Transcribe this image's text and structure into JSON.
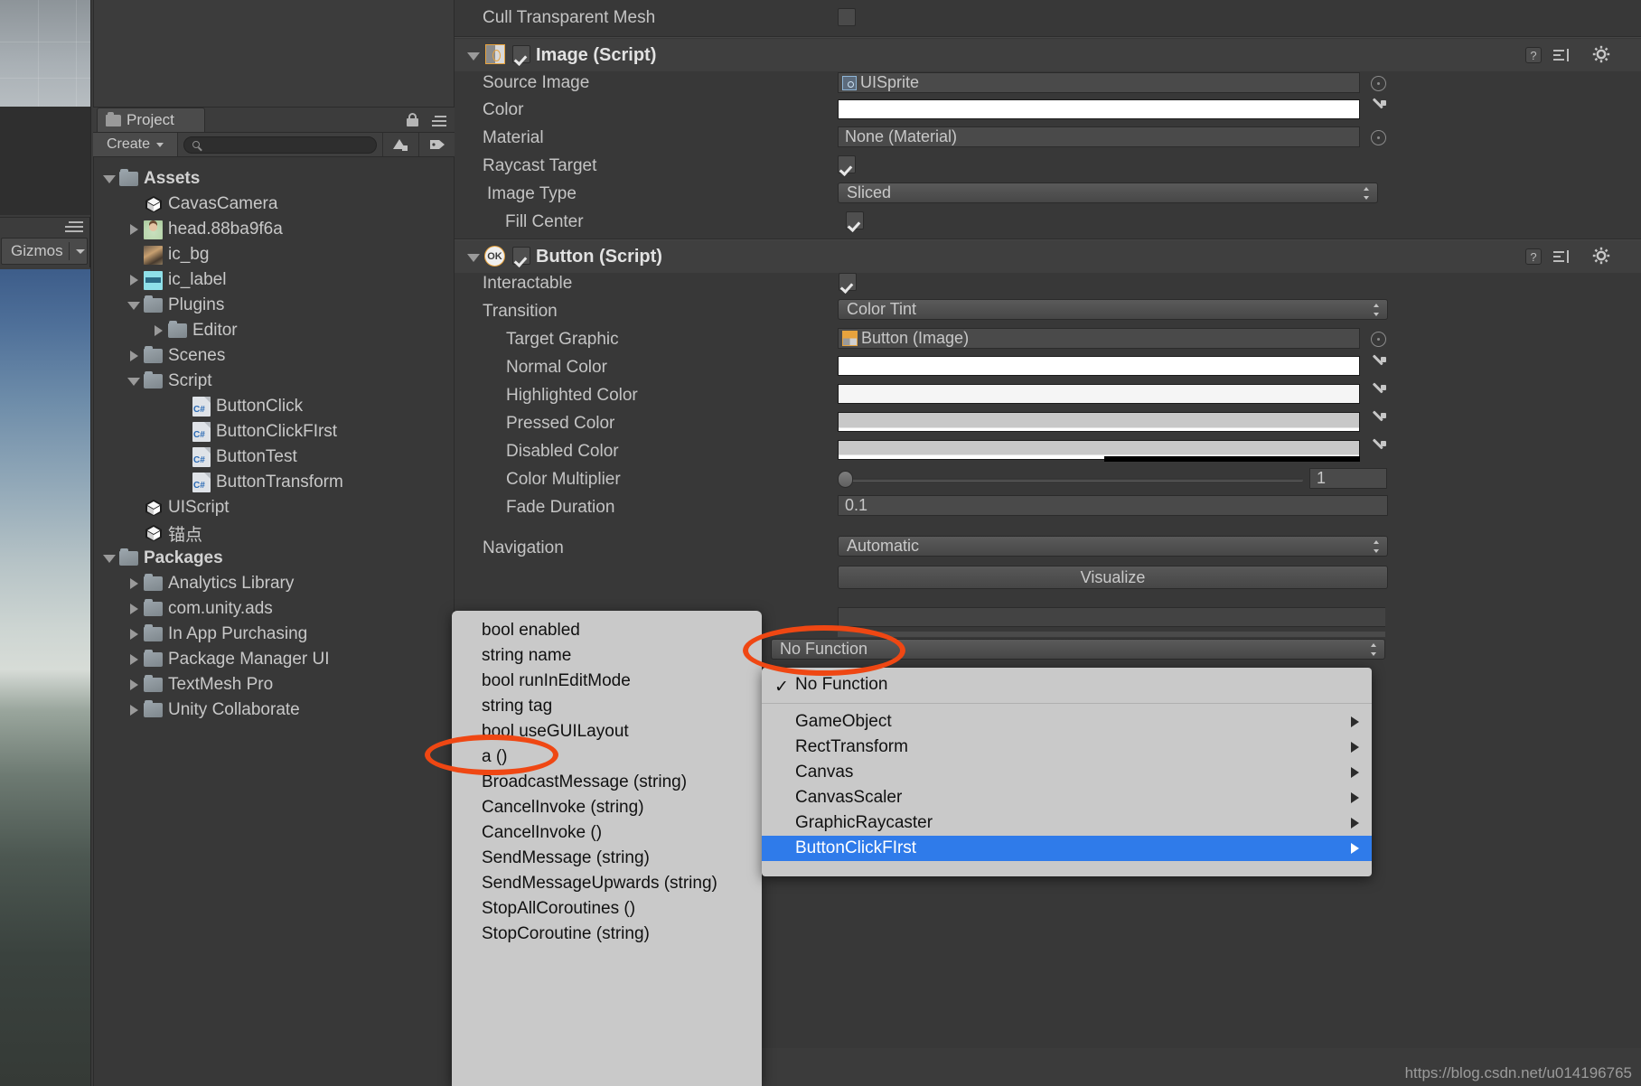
{
  "scene": {
    "gizmos_label": "Gizmos",
    "gizmos_menu_icon": "hamburger-menu-icon",
    "gizmos_caret_icon": "caret-down-icon"
  },
  "project": {
    "tab_label": "Project",
    "tab_icon": "folder-icon",
    "lock_icon": "lock-icon",
    "menu_icon": "hamburger-menu-icon",
    "create_label": "Create",
    "search_placeholder": "",
    "search_value": "",
    "search_icon": "magnifier-icon",
    "toolbar_icons": [
      "favorite-filter-icon",
      "label-filter-icon"
    ],
    "tree": [
      {
        "label": "Assets",
        "icon": "folder-icon",
        "twisty": "open",
        "depth": 0,
        "bold": true
      },
      {
        "label": "CavasCamera",
        "icon": "unity-prefab-icon",
        "twisty": "none",
        "depth": 1,
        "bold": false
      },
      {
        "label": "head.88ba9f6a",
        "icon": "image-head-icon",
        "twisty": "closed",
        "depth": 1,
        "bold": false
      },
      {
        "label": "ic_bg",
        "icon": "image-bg-icon",
        "twisty": "none",
        "depth": 1,
        "bold": false
      },
      {
        "label": "ic_label",
        "icon": "image-label-icon",
        "twisty": "closed",
        "depth": 1,
        "bold": false
      },
      {
        "label": "Plugins",
        "icon": "folder-icon",
        "twisty": "open",
        "depth": 1,
        "bold": false
      },
      {
        "label": "Editor",
        "icon": "folder-icon",
        "twisty": "closed",
        "depth": 2,
        "bold": false
      },
      {
        "label": "Scenes",
        "icon": "folder-icon",
        "twisty": "closed",
        "depth": 1,
        "bold": false
      },
      {
        "label": "Script",
        "icon": "folder-icon",
        "twisty": "open",
        "depth": 1,
        "bold": false
      },
      {
        "label": "ButtonClick",
        "icon": "csharp-script-icon",
        "twisty": "none",
        "depth": 3,
        "bold": false
      },
      {
        "label": "ButtonClickFIrst",
        "icon": "csharp-script-icon",
        "twisty": "none",
        "depth": 3,
        "bold": false
      },
      {
        "label": "ButtonTest",
        "icon": "csharp-script-icon",
        "twisty": "none",
        "depth": 3,
        "bold": false
      },
      {
        "label": "ButtonTransform",
        "icon": "csharp-script-icon",
        "twisty": "none",
        "depth": 3,
        "bold": false
      },
      {
        "label": "UIScript",
        "icon": "unity-prefab-icon",
        "twisty": "none",
        "depth": 1,
        "bold": false
      },
      {
        "label": "锚点",
        "icon": "unity-prefab-icon",
        "twisty": "none",
        "depth": 1,
        "bold": false
      },
      {
        "label": "Packages",
        "icon": "folder-icon",
        "twisty": "open",
        "depth": 0,
        "bold": true
      },
      {
        "label": "Analytics Library",
        "icon": "folder-icon",
        "twisty": "closed",
        "depth": 1,
        "bold": false
      },
      {
        "label": "com.unity.ads",
        "icon": "folder-icon",
        "twisty": "closed",
        "depth": 1,
        "bold": false
      },
      {
        "label": "In App Purchasing",
        "icon": "folder-icon",
        "twisty": "closed",
        "depth": 1,
        "bold": false
      },
      {
        "label": "Package Manager UI",
        "icon": "folder-icon",
        "twisty": "closed",
        "depth": 1,
        "bold": false
      },
      {
        "label": "TextMesh Pro",
        "icon": "folder-icon",
        "twisty": "closed",
        "depth": 1,
        "bold": false
      },
      {
        "label": "Unity Collaborate",
        "icon": "folder-icon",
        "twisty": "closed",
        "depth": 1,
        "bold": false
      }
    ]
  },
  "inspector": {
    "cull_transparent_mesh": {
      "label": "Cull Transparent Mesh",
      "checked": false
    },
    "image_component": {
      "title": "Image (Script)",
      "enabled": true,
      "badge": "image-script-badge-icon",
      "help_icon": "help-icon",
      "preset_icon": "preset-icon",
      "gear_icon": "gear-icon",
      "rows": [
        {
          "label": "Source Image",
          "type": "object",
          "value": "UISprite",
          "icon": "sprite-icon"
        },
        {
          "label": "Color",
          "type": "color",
          "value": "#ffffff"
        },
        {
          "label": "Material",
          "type": "object",
          "value": "None (Material)",
          "icon": ""
        },
        {
          "label": "Raycast Target",
          "type": "check",
          "checked": true
        },
        {
          "label": "Image Type",
          "type": "popup",
          "value": "Sliced"
        },
        {
          "label": "Fill Center",
          "type": "check",
          "checked": true,
          "indent": true
        }
      ]
    },
    "button_component": {
      "title": "Button (Script)",
      "enabled": true,
      "badge": "ok-script-badge-icon",
      "help_icon": "help-icon",
      "preset_icon": "preset-icon",
      "gear_icon": "gear-icon",
      "rows": [
        {
          "label": "Interactable",
          "type": "check",
          "checked": true
        },
        {
          "label": "Transition",
          "type": "popup",
          "value": "Color Tint"
        },
        {
          "label": "Target Graphic",
          "type": "object",
          "value": "Button (Image)",
          "icon": "image-icon",
          "indent": true
        },
        {
          "label": "Normal Color",
          "type": "color",
          "value": "#ffffff",
          "indent": true
        },
        {
          "label": "Highlighted Color",
          "type": "color",
          "value": "#f5f5f5",
          "indent": true
        },
        {
          "label": "Pressed Color",
          "type": "color",
          "value": "#c8c8c8",
          "indent": true
        },
        {
          "label": "Disabled Color",
          "type": "color",
          "value": "#c8c8c8",
          "alpha": 0.5,
          "indent": true
        },
        {
          "label": "Color Multiplier",
          "type": "slider",
          "value": "1",
          "indent": true
        },
        {
          "label": "Fade Duration",
          "type": "text",
          "value": "0.1",
          "indent": true
        },
        {
          "label": "Navigation",
          "type": "popup",
          "value": "Automatic"
        }
      ],
      "visualize_label": "Visualize"
    },
    "onclick_function_field": {
      "value": "No Function"
    }
  },
  "popup_properties": {
    "items": [
      "bool enabled",
      "string name",
      "bool runInEditMode",
      "string tag",
      "bool useGUILayout",
      "a ()",
      "BroadcastMessage (string)",
      "CancelInvoke (string)",
      "CancelInvoke ()",
      "SendMessage (string)",
      "SendMessageUpwards (string)",
      "StopAllCoroutines ()",
      "StopCoroutine (string)"
    ],
    "highlighted": "a ()"
  },
  "popup_functions": {
    "checked_item": "No Function",
    "check_glyph": "✓",
    "items": [
      {
        "label": "GameObject",
        "submenu": true,
        "selected": false
      },
      {
        "label": "RectTransform",
        "submenu": true,
        "selected": false
      },
      {
        "label": "Canvas",
        "submenu": true,
        "selected": false
      },
      {
        "label": "CanvasScaler",
        "submenu": true,
        "selected": false
      },
      {
        "label": "GraphicRaycaster",
        "submenu": true,
        "selected": false
      },
      {
        "label": "ButtonClickFIrst",
        "submenu": true,
        "selected": true
      }
    ]
  },
  "annotations": {
    "color": "#ef4713",
    "ellipses": [
      "no-function-field-highlight",
      "a-method-highlight"
    ]
  },
  "footer": {
    "watermark": "https://blog.csdn.net/u014196765"
  }
}
